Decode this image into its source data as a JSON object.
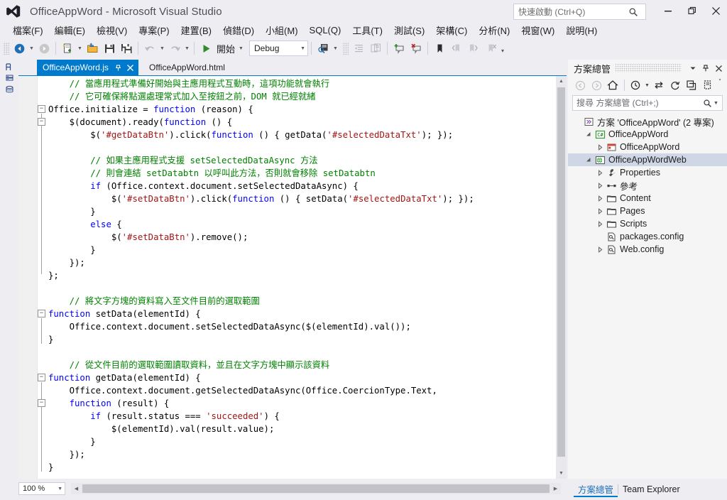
{
  "window": {
    "title": "OfficeAppWord - Microsoft Visual Studio",
    "logo_icon": "visual-studio-logo-icon",
    "minimize_label": "—",
    "maximize_label": "❐",
    "close_label": "✕"
  },
  "quick_launch": {
    "placeholder": "快速啟動 (Ctrl+Q)",
    "value": "",
    "icon": "search-icon"
  },
  "menubar": {
    "items": [
      {
        "label": "檔案(F)"
      },
      {
        "label": "編輯(E)"
      },
      {
        "label": "檢視(V)"
      },
      {
        "label": "專案(P)"
      },
      {
        "label": "建置(B)"
      },
      {
        "label": "偵錯(D)"
      },
      {
        "label": "小組(M)"
      },
      {
        "label": "SQL(Q)"
      },
      {
        "label": "工具(T)"
      },
      {
        "label": "測試(S)"
      },
      {
        "label": "架構(C)"
      },
      {
        "label": "分析(N)"
      },
      {
        "label": "視窗(W)"
      },
      {
        "label": "說明(H)"
      }
    ]
  },
  "toolbar": {
    "navigate_back_icon": "navigate-back-icon",
    "navigate_forward_icon": "navigate-forward-icon",
    "new_project_icon": "new-project-icon",
    "open_file_icon": "open-file-icon",
    "save_icon": "save-icon",
    "save_all_icon": "save-all-icon",
    "undo_icon": "undo-icon",
    "redo_icon": "redo-icon",
    "start_icon": "start-debug-icon",
    "start_label": "開始",
    "config_value": "Debug",
    "find_icon": "find-in-files-icon",
    "indent_icon": "decrease-indent-icon",
    "comment_icon": "comment-selection-icon",
    "breakpoint_add_icon": "add-breakpoint-icon",
    "breakpoint_delete_icon": "delete-breakpoint-icon",
    "bookmark_icon": "bookmark-icon",
    "prev_bookmark_icon": "previous-bookmark-icon",
    "next_bookmark_icon": "next-bookmark-icon",
    "clear_bookmarks_icon": "clear-bookmarks-icon",
    "overflow_label": "▾"
  },
  "left_strip": {
    "toolbox_icon": "toolbox-icon",
    "server_explorer_icon": "server-explorer-icon",
    "data_sources_icon": "data-sources-icon"
  },
  "editor": {
    "tabs": [
      {
        "label": "OfficeAppWord.js",
        "active": true,
        "pin_icon": "pin-icon",
        "close_icon": "close-icon"
      },
      {
        "label": "OfficeAppWord.html",
        "active": false
      }
    ],
    "zoom": "100 %",
    "code_lines": [
      {
        "indent": 1,
        "tokens": [
          {
            "t": "cm",
            "s": "// 當應用程式準備好開始與主應用程式互動時，這項功能就會執行"
          }
        ]
      },
      {
        "indent": 1,
        "tokens": [
          {
            "t": "cm",
            "s": "// 它可確保將點選處理常式加入至按鈕之前，DOM 就已經就緒"
          }
        ]
      },
      {
        "indent": 0,
        "tokens": [
          {
            "t": "pl",
            "s": "Office.initialize = "
          },
          {
            "t": "kw",
            "s": "function"
          },
          {
            "t": "pl",
            "s": " (reason) {"
          }
        ]
      },
      {
        "indent": 1,
        "tokens": [
          {
            "t": "pl",
            "s": "$(document).ready("
          },
          {
            "t": "kw",
            "s": "function"
          },
          {
            "t": "pl",
            "s": " () {"
          }
        ]
      },
      {
        "indent": 2,
        "tokens": [
          {
            "t": "pl",
            "s": "$("
          },
          {
            "t": "st",
            "s": "'#getDataBtn'"
          },
          {
            "t": "pl",
            "s": ").click("
          },
          {
            "t": "kw",
            "s": "function"
          },
          {
            "t": "pl",
            "s": " () { getData("
          },
          {
            "t": "st",
            "s": "'#selectedDataTxt'"
          },
          {
            "t": "pl",
            "s": "); });"
          }
        ]
      },
      {
        "indent": 0,
        "tokens": []
      },
      {
        "indent": 2,
        "tokens": [
          {
            "t": "cm",
            "s": "// 如果主應用程式支援 setSelectedDataAsync 方法"
          }
        ]
      },
      {
        "indent": 2,
        "tokens": [
          {
            "t": "cm",
            "s": "// 則會連結 setDatabtn 以呼叫此方法，否則就會移除 setDatabtn"
          }
        ]
      },
      {
        "indent": 2,
        "tokens": [
          {
            "t": "kw",
            "s": "if"
          },
          {
            "t": "pl",
            "s": " (Office.context.document.setSelectedDataAsync) {"
          }
        ]
      },
      {
        "indent": 3,
        "tokens": [
          {
            "t": "pl",
            "s": "$("
          },
          {
            "t": "st",
            "s": "'#setDataBtn'"
          },
          {
            "t": "pl",
            "s": ").click("
          },
          {
            "t": "kw",
            "s": "function"
          },
          {
            "t": "pl",
            "s": " () { setData("
          },
          {
            "t": "st",
            "s": "'#selectedDataTxt'"
          },
          {
            "t": "pl",
            "s": "); });"
          }
        ]
      },
      {
        "indent": 2,
        "tokens": [
          {
            "t": "pl",
            "s": "}"
          }
        ]
      },
      {
        "indent": 2,
        "tokens": [
          {
            "t": "kw",
            "s": "else"
          },
          {
            "t": "pl",
            "s": " {"
          }
        ]
      },
      {
        "indent": 3,
        "tokens": [
          {
            "t": "pl",
            "s": "$("
          },
          {
            "t": "st",
            "s": "'#setDataBtn'"
          },
          {
            "t": "pl",
            "s": ").remove();"
          }
        ]
      },
      {
        "indent": 2,
        "tokens": [
          {
            "t": "pl",
            "s": "}"
          }
        ]
      },
      {
        "indent": 1,
        "tokens": [
          {
            "t": "pl",
            "s": "});"
          }
        ]
      },
      {
        "indent": 0,
        "tokens": [
          {
            "t": "pl",
            "s": "};"
          }
        ]
      },
      {
        "indent": 0,
        "tokens": []
      },
      {
        "indent": 1,
        "tokens": [
          {
            "t": "cm",
            "s": "// 將文字方塊的資料寫入至文件目前的選取範圍"
          }
        ]
      },
      {
        "indent": 0,
        "tokens": [
          {
            "t": "kw",
            "s": "function"
          },
          {
            "t": "pl",
            "s": " setData(elementId) {"
          }
        ]
      },
      {
        "indent": 1,
        "tokens": [
          {
            "t": "pl",
            "s": "Office.context.document.setSelectedDataAsync($(elementId).val());"
          }
        ]
      },
      {
        "indent": 0,
        "tokens": [
          {
            "t": "pl",
            "s": "}"
          }
        ]
      },
      {
        "indent": 0,
        "tokens": []
      },
      {
        "indent": 1,
        "tokens": [
          {
            "t": "cm",
            "s": "// 從文件目前的選取範圍讀取資料，並且在文字方塊中顯示該資料"
          }
        ]
      },
      {
        "indent": 0,
        "tokens": [
          {
            "t": "kw",
            "s": "function"
          },
          {
            "t": "pl",
            "s": " getData(elementId) {"
          }
        ]
      },
      {
        "indent": 1,
        "tokens": [
          {
            "t": "pl",
            "s": "Office.context.document.getSelectedDataAsync(Office.CoercionType.Text,"
          }
        ]
      },
      {
        "indent": 1,
        "tokens": [
          {
            "t": "kw",
            "s": "function"
          },
          {
            "t": "pl",
            "s": " (result) {"
          }
        ]
      },
      {
        "indent": 2,
        "tokens": [
          {
            "t": "kw",
            "s": "if"
          },
          {
            "t": "pl",
            "s": " (result.status === "
          },
          {
            "t": "st",
            "s": "'succeeded'"
          },
          {
            "t": "pl",
            "s": ") {"
          }
        ]
      },
      {
        "indent": 3,
        "tokens": [
          {
            "t": "pl",
            "s": "$(elementId).val(result.value);"
          }
        ]
      },
      {
        "indent": 2,
        "tokens": [
          {
            "t": "pl",
            "s": "}"
          }
        ]
      },
      {
        "indent": 1,
        "tokens": [
          {
            "t": "pl",
            "s": "});"
          }
        ]
      },
      {
        "indent": 0,
        "tokens": [
          {
            "t": "pl",
            "s": "}"
          }
        ]
      }
    ]
  },
  "solution_explorer": {
    "title": "方案總管",
    "dropdown_icon": "chevron-down-icon",
    "pin_icon": "pin-icon",
    "close_icon": "close-icon",
    "toolbar": {
      "back_icon": "back-icon",
      "forward_icon": "forward-icon",
      "home_icon": "home-icon",
      "pending_changes_icon": "pending-changes-icon",
      "sync_icon": "sync-with-active-document-icon",
      "refresh_icon": "refresh-icon",
      "collapse_all_icon": "collapse-all-icon",
      "show_all_files_icon": "show-all-files-icon",
      "overflow_icon": "toolbar-overflow-icon"
    },
    "search": {
      "placeholder": "搜尋 方案總管 (Ctrl+;)",
      "value": "",
      "icon": "search-icon",
      "dropdown_icon": "chevron-down-icon"
    },
    "tree": [
      {
        "depth": 0,
        "expander": "",
        "icon": "solution-icon",
        "label": "方案 'OfficeAppWord' (2 專案)",
        "selected": false
      },
      {
        "depth": 1,
        "expander": "▲",
        "icon": "csharp-project-icon",
        "label": "OfficeAppWord",
        "selected": false
      },
      {
        "depth": 2,
        "expander": "▶",
        "icon": "office-app-icon",
        "label": "OfficeAppWord",
        "selected": false
      },
      {
        "depth": 1,
        "expander": "▲",
        "icon": "web-project-icon",
        "label": "OfficeAppWordWeb",
        "selected": true
      },
      {
        "depth": 2,
        "expander": "▶",
        "icon": "properties-icon",
        "label": "Properties",
        "selected": false
      },
      {
        "depth": 2,
        "expander": "▶",
        "icon": "references-icon",
        "label": "參考",
        "selected": false
      },
      {
        "depth": 2,
        "expander": "▶",
        "icon": "folder-icon",
        "label": "Content",
        "selected": false
      },
      {
        "depth": 2,
        "expander": "▶",
        "icon": "folder-icon",
        "label": "Pages",
        "selected": false
      },
      {
        "depth": 2,
        "expander": "▶",
        "icon": "folder-icon",
        "label": "Scripts",
        "selected": false
      },
      {
        "depth": 2,
        "expander": "",
        "icon": "config-file-icon",
        "label": "packages.config",
        "selected": false
      },
      {
        "depth": 2,
        "expander": "▶",
        "icon": "config-file-icon",
        "label": "Web.config",
        "selected": false
      }
    ],
    "dock_tabs": [
      {
        "label": "方案總管",
        "active": true
      },
      {
        "label": "Team Explorer",
        "active": false
      }
    ]
  },
  "colors": {
    "accent": "#007acc",
    "selection": "#cfd6e6",
    "comment": "#008000",
    "keyword": "#0000ff",
    "string": "#a31515",
    "chrome": "#eeeef2"
  }
}
